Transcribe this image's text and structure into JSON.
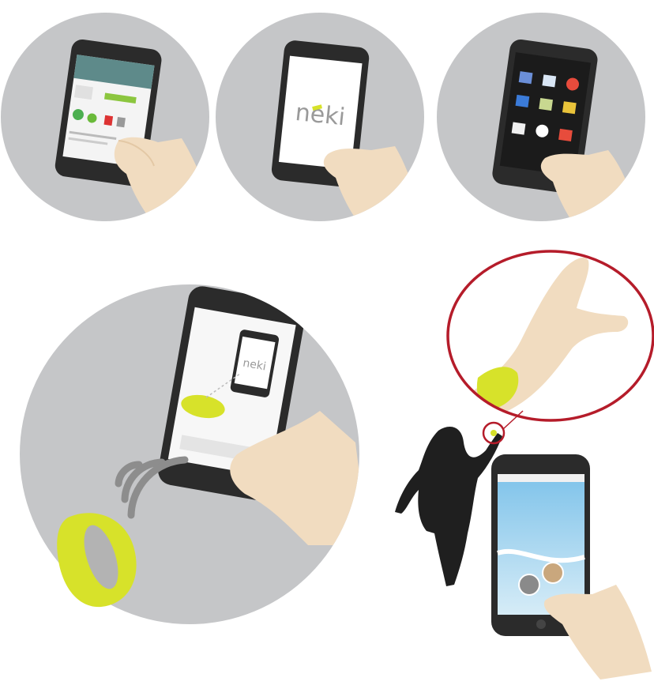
{
  "panels": {
    "step1": {
      "screen_tiles": [
        "green",
        "green",
        "red"
      ]
    },
    "step2": {
      "logo_text": "neki"
    },
    "step3": {
      "grid_tiles": [
        "#6b8fd8",
        "#d9e6f5",
        "#3b7bd8",
        "#c8d890",
        "#e9c33a",
        "#f0f0f0",
        "#e74c3c",
        "#ffffff"
      ]
    },
    "step4": {
      "logo_text": "neki"
    }
  },
  "colors": {
    "circle_gray": "#c5c6c8",
    "phone_body": "#2b2b2b",
    "bracelet": "#d7e22a",
    "skin": "#f1dcc0",
    "highlight_ring": "#b51c2a",
    "silhouette": "#1f1f1f"
  }
}
